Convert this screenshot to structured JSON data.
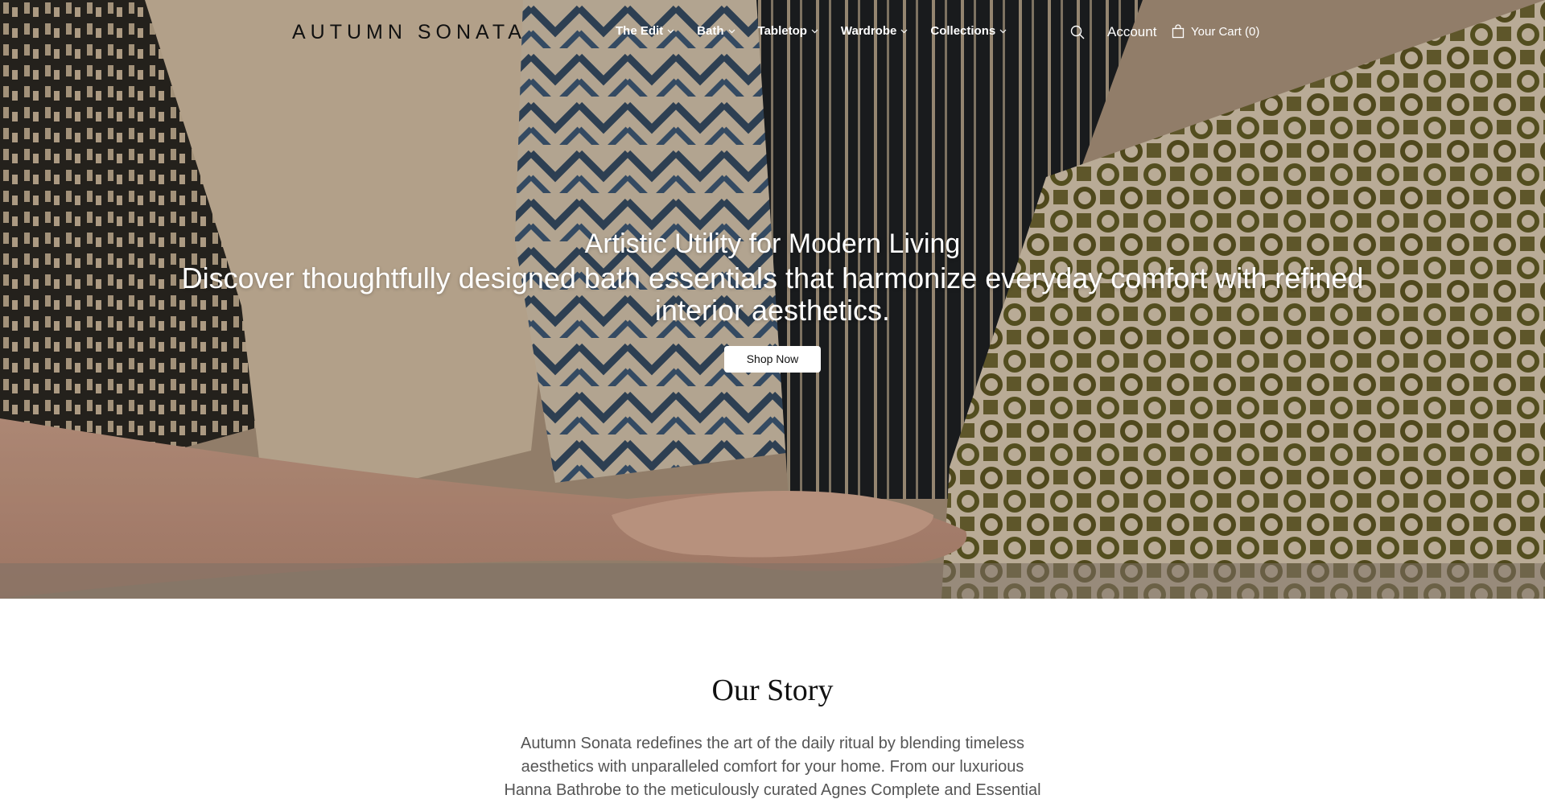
{
  "brand": {
    "logo_text": "AUTUMN SONATA"
  },
  "nav": {
    "items": [
      {
        "label": "The Edit"
      },
      {
        "label": "Bath"
      },
      {
        "label": "Tabletop"
      },
      {
        "label": "Wardrobe"
      },
      {
        "label": "Collections"
      }
    ],
    "account_label": "Account",
    "cart_label": "Your Cart (0)",
    "icons": [
      "search-icon",
      "shopping-bag-icon",
      "chevron-down-icon"
    ]
  },
  "hero": {
    "title": "Artistic Utility for Modern Living",
    "subtitle": "Discover thoughtfully designed bath essentials that harmonize everyday comfort with refined interior aesthetics.",
    "cta_label": "Shop Now",
    "image_description": "Hands holding a bundle of patterned towels"
  },
  "story": {
    "title": "Our Story",
    "body": "Autumn Sonata redefines the art of the daily ritual by blending timeless aesthetics with unparalleled comfort for your home. From our luxurious Hanna Bathrobe to the meticulously curated Agnes Complete and Essential sets, we"
  },
  "colors": {
    "nav_text": "#ffffff",
    "logo": "#111111",
    "button_bg": "#ffffff",
    "story_text": "#555555"
  }
}
